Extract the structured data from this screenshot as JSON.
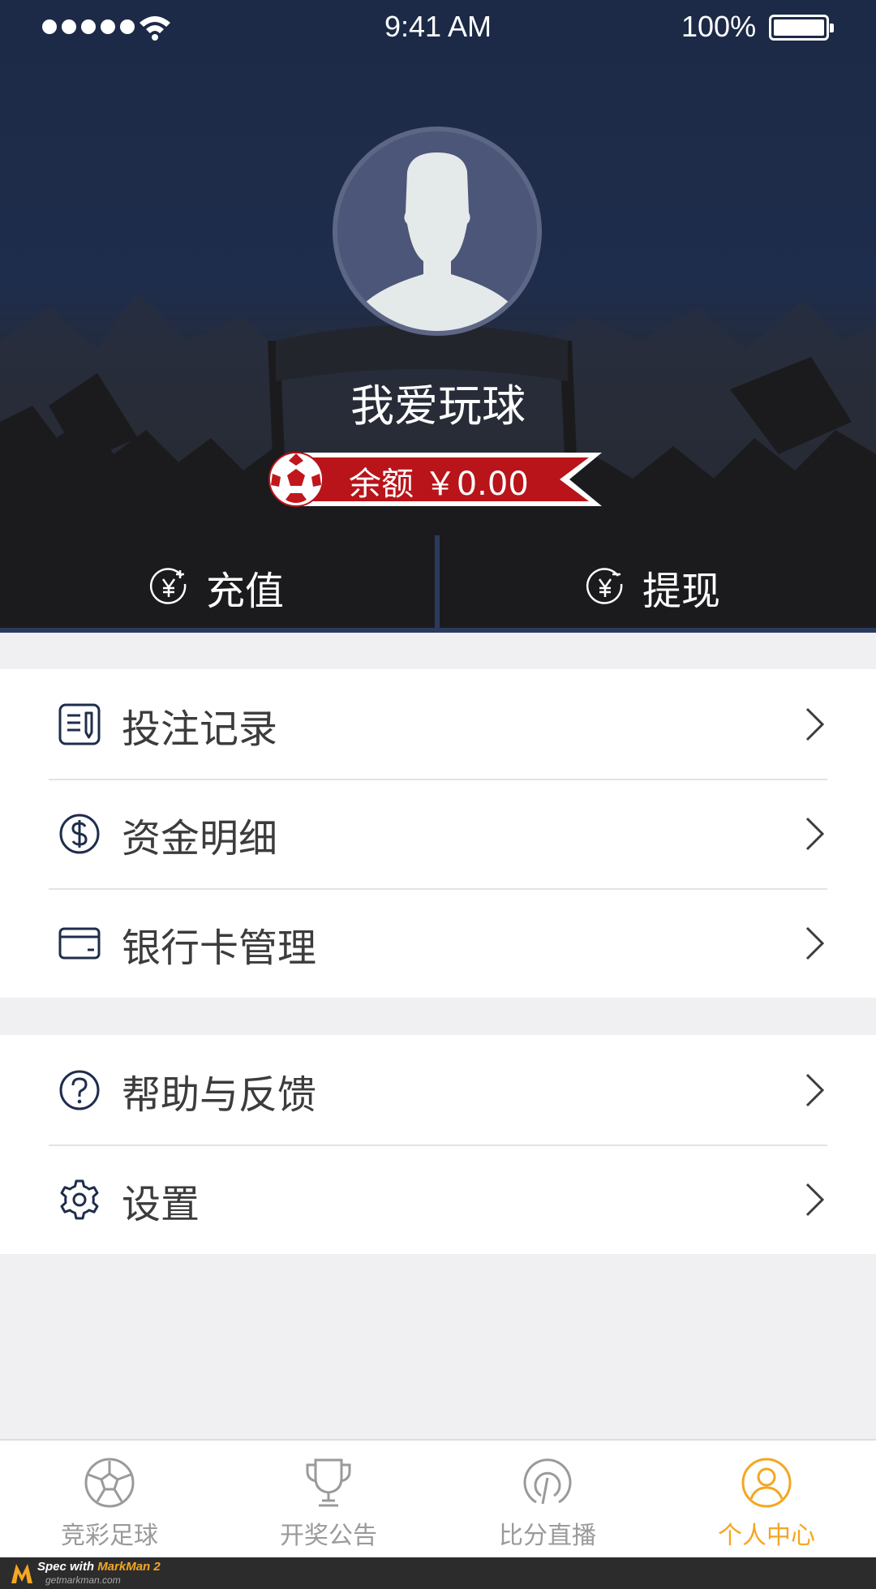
{
  "status_bar": {
    "time": "9:41 AM",
    "battery": "100%"
  },
  "profile": {
    "username": "我爱玩球",
    "balance_label": "余额 ￥0.00"
  },
  "actions": [
    {
      "label": "充值",
      "icon": "yuan-plus-icon"
    },
    {
      "label": "提现",
      "icon": "yuan-minus-icon"
    }
  ],
  "menu_group_1": [
    {
      "label": "投注记录",
      "icon": "bet-record-icon"
    },
    {
      "label": "资金明细",
      "icon": "dollar-circle-icon"
    },
    {
      "label": "银行卡管理",
      "icon": "bank-card-icon"
    }
  ],
  "menu_group_2": [
    {
      "label": "帮助与反馈",
      "icon": "question-circle-icon"
    },
    {
      "label": "设置",
      "icon": "gear-icon"
    }
  ],
  "tabs": [
    {
      "label": "竞彩足球",
      "icon": "soccer-ball-icon",
      "active": false
    },
    {
      "label": "开奖公告",
      "icon": "trophy-icon",
      "active": false
    },
    {
      "label": "比分直播",
      "icon": "live-score-icon",
      "active": false
    },
    {
      "label": "个人中心",
      "icon": "user-circle-icon",
      "active": true
    }
  ],
  "footer": {
    "brand": "Spec with",
    "product": "MarkMan 2",
    "site": "getmarkman.com"
  },
  "colors": {
    "header_bg": "#1f2d4c",
    "ribbon_red": "#b8141a",
    "accent": "#f5a623",
    "icon_navy": "#1f2d4c"
  }
}
